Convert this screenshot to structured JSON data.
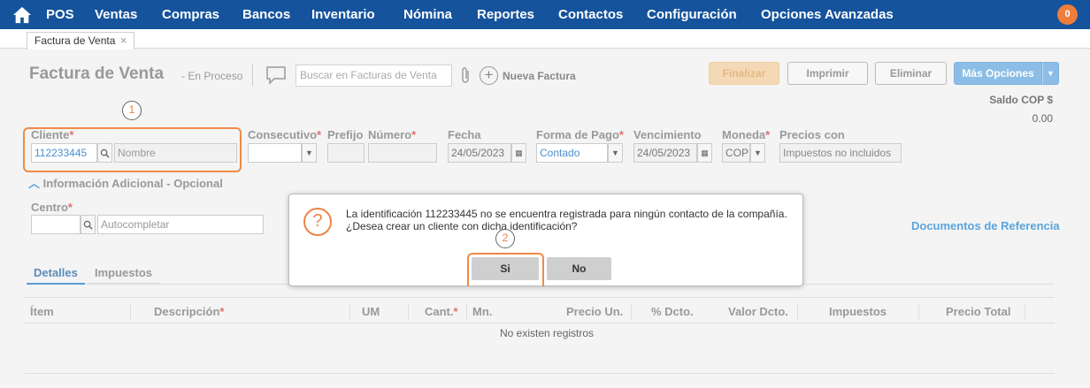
{
  "nav": {
    "items": [
      "POS",
      "Ventas",
      "Compras",
      "Bancos",
      "Inventario",
      "Nómina",
      "Reportes",
      "Contactos",
      "Configuración",
      "Opciones Avanzadas"
    ],
    "badge": "0"
  },
  "tab": {
    "label": "Factura de Venta",
    "close": "×"
  },
  "header": {
    "title": "Factura de Venta",
    "status": "- En Proceso",
    "search_placeholder": "Buscar en Facturas de Venta",
    "new_invoice": "Nueva Factura"
  },
  "actions": {
    "finalizar": "Finalizar",
    "imprimir": "Imprimir",
    "eliminar": "Eliminar",
    "mas_opciones": "Más Opciones"
  },
  "saldo": {
    "label": "Saldo COP $",
    "value": "0.00"
  },
  "form": {
    "cliente_label": "Cliente",
    "cliente_id": "112233445",
    "nombre_placeholder": "Nombre",
    "consecutivo_label": "Consecutivo",
    "prefijo_label": "Prefijo",
    "numero_label": "Número",
    "fecha_label": "Fecha",
    "fecha_value": "24/05/2023",
    "forma_pago_label": "Forma de Pago",
    "forma_pago_value": "Contado",
    "vencimiento_label": "Vencimiento",
    "vencimiento_value": "24/05/2023",
    "moneda_label": "Moneda",
    "moneda_value": "COP",
    "precios_label": "Precios con",
    "precios_value": "Impuestos no incluidos",
    "required_mark": "*"
  },
  "info_adicional": "Información Adicional - Opcional",
  "centro": {
    "label": "Centro",
    "placeholder": "Autocompletar"
  },
  "docs_ref": "Documentos de Referencia",
  "tabs": [
    "Detalles",
    "Impuestos"
  ],
  "table": {
    "headers": [
      "Ítem",
      "Descripción",
      "UM",
      "Cant.",
      "Mn.",
      "Precio Un.",
      "% Dcto.",
      "Valor Dcto.",
      "Impuestos",
      "Precio Total"
    ],
    "empty": "No existen registros"
  },
  "dialog": {
    "line1": "La identificación 112233445 no se encuentra registrada para ningún contacto de la compañía.",
    "line2": "¿Desea crear un cliente con dicha identificación?",
    "yes": "Si",
    "no": "No"
  },
  "markers": [
    "1",
    "2"
  ],
  "colors": {
    "nav": "#15539c",
    "accent": "#ef7d3c",
    "link": "#5aa5dc"
  }
}
